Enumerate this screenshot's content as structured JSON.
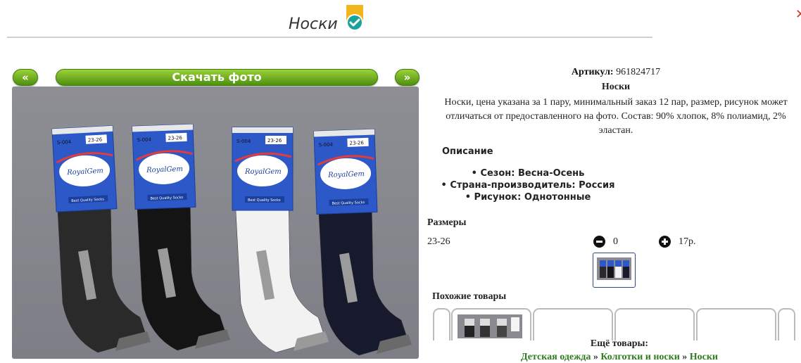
{
  "header": {
    "title": "Носки"
  },
  "colors": {
    "accent_green": "#5aa217",
    "badge_teal": "#1aa39a",
    "badge_yellow": "#f2b51c",
    "link_green": "#2e7d1e"
  },
  "icons": [
    "check-badge-icon",
    "minus-circle-icon",
    "plus-circle-icon"
  ],
  "photo_nav": {
    "prev_label": "«",
    "download_label": "Скачать фото",
    "next_label": "»"
  },
  "photo": {
    "socks": [
      {
        "size_tag": "S-004",
        "size_range": "23-26",
        "brand": "RoyalGem",
        "tagline": "Best Quality Socks",
        "color": "#2a2a2a"
      },
      {
        "size_tag": "S-004",
        "size_range": "23-26",
        "brand": "RoyalGem",
        "tagline": "Best Quality Socks",
        "color": "#141414"
      },
      {
        "size_tag": "S-004",
        "size_range": "23-26",
        "brand": "RoyalGem",
        "tagline": "Best Quality Socks",
        "color": "#f2f2f2"
      },
      {
        "size_tag": "S-004",
        "size_range": "23-26",
        "brand": "RoyalGem",
        "tagline": "Best Quality Socks",
        "color": "#161a2c"
      }
    ]
  },
  "product": {
    "article_label": "Артикул:",
    "article_value": "961824717",
    "name": "Носки",
    "description": "Носки, цена указана за 1 пару, минимальный заказ 12 пар, размер, рисунок может отличаться от предоставленного на фото. Состав: 90% хлопок, 8% полиамид, 2% эластан.",
    "details_title": "Описание",
    "bullets": [
      "Сезон: Весна-Осень",
      "Страна-производитель: Россия",
      "Рисунок: Однотонные"
    ]
  },
  "sizes": {
    "title": "Размеры",
    "rows": [
      {
        "size": "23-26",
        "quantity": "0",
        "price": "17р."
      }
    ]
  },
  "similar": {
    "title": "Похожие товары"
  },
  "more": {
    "title": "Ещё товары:",
    "breadcrumb": [
      "Детская одежда",
      "Колготки и носки",
      "Носки"
    ],
    "separator": "»"
  }
}
